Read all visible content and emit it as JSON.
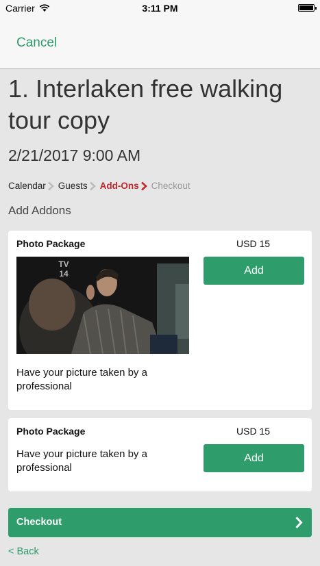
{
  "status_bar": {
    "carrier": "Carrier",
    "time": "3:11 PM"
  },
  "nav": {
    "cancel_label": "Cancel"
  },
  "tour": {
    "title": "1. Interlaken free walking tour copy",
    "date": "2/21/2017 9:00 AM"
  },
  "breadcrumb": {
    "steps": [
      "Calendar",
      "Guests",
      "Add-Ons",
      "Checkout"
    ],
    "active_index": 2
  },
  "addons": {
    "heading": "Add Addons",
    "items": [
      {
        "name": "Photo Package",
        "price": "USD 15",
        "description": "Have your picture taken by a professional",
        "add_label": "Add",
        "image_badge": "TV 14"
      },
      {
        "name": "Photo Package",
        "price": "USD 15",
        "description": "Have your picture taken by a professional",
        "add_label": "Add"
      }
    ]
  },
  "footer": {
    "checkout_label": "Checkout",
    "back_label": "< Back"
  },
  "colors": {
    "accent": "#2f9c6b",
    "active_step": "#c0272d",
    "inactive_step": "#9a9a9a"
  },
  "icons": [
    "wifi-icon",
    "battery-icon",
    "chevron-right-icon"
  ]
}
